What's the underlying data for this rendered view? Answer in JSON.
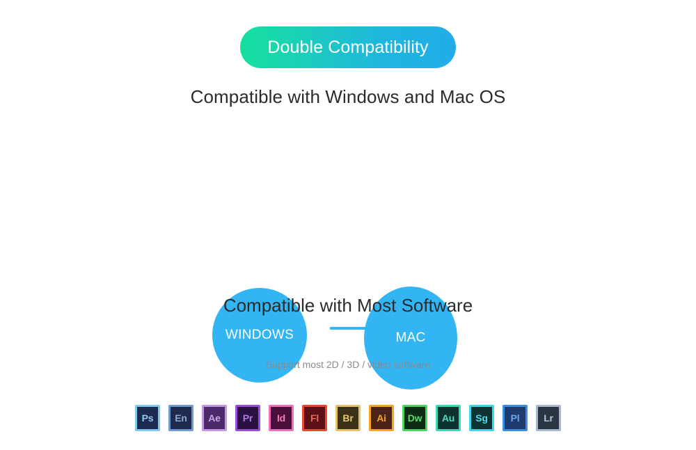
{
  "banner": {
    "title": "Double Compatibility",
    "gradient_from": "#16dfa0",
    "gradient_to": "#21ace9"
  },
  "os_section": {
    "subtitle": "Compatible with Windows and Mac OS",
    "circle_color": "#33b4f3",
    "circles": [
      {
        "label": "WINDOWS"
      },
      {
        "label": "MAC"
      }
    ]
  },
  "software_section": {
    "heading": "Compatible with Most Software",
    "divider_color": "#33b4f3",
    "note": "Support most 2D / 3D / video software",
    "icons": [
      {
        "label": "Ps",
        "name": "photoshop",
        "fill": "#1c2b4f",
        "border": "#7fc9ea",
        "text": "#8fc8ee"
      },
      {
        "label": "En",
        "name": "encore",
        "fill": "#1e2a4e",
        "border": "#6f9bd1",
        "text": "#8aa9d8"
      },
      {
        "label": "Ae",
        "name": "after-effects",
        "fill": "#4a2a6b",
        "border": "#c497e2",
        "text": "#cda6e8"
      },
      {
        "label": "Pr",
        "name": "premiere-pro",
        "fill": "#2a1142",
        "border": "#9b4fd8",
        "text": "#b07ae0"
      },
      {
        "label": "Id",
        "name": "indesign",
        "fill": "#4b1039",
        "border": "#ef6fbf",
        "text": "#f07dc4"
      },
      {
        "label": "Fl",
        "name": "flash",
        "fill": "#5c1119",
        "border": "#e54a30",
        "text": "#e86a58"
      },
      {
        "label": "Br",
        "name": "bridge",
        "fill": "#3a3118",
        "border": "#e8c06b",
        "text": "#e9c573"
      },
      {
        "label": "Ai",
        "name": "illustrator",
        "fill": "#4b2417",
        "border": "#f5a623",
        "text": "#f4a733"
      },
      {
        "label": "Dw",
        "name": "dreamweaver",
        "fill": "#0e2c15",
        "border": "#4ed45e",
        "text": "#5cd86c"
      },
      {
        "label": "Au",
        "name": "audition",
        "fill": "#0d3330",
        "border": "#3bd9b8",
        "text": "#4fdcc0"
      },
      {
        "label": "Sg",
        "name": "speedgrade",
        "fill": "#0d3335",
        "border": "#3fd8e8",
        "text": "#51dcea"
      },
      {
        "label": "Pl",
        "name": "prelude",
        "fill": "#1e3a6e",
        "border": "#3a8fe0",
        "text": "#6aa8e8"
      },
      {
        "label": "Lr",
        "name": "lightroom",
        "fill": "#2b3642",
        "border": "#a8b8d0",
        "text": "#b6c3d6"
      }
    ]
  }
}
